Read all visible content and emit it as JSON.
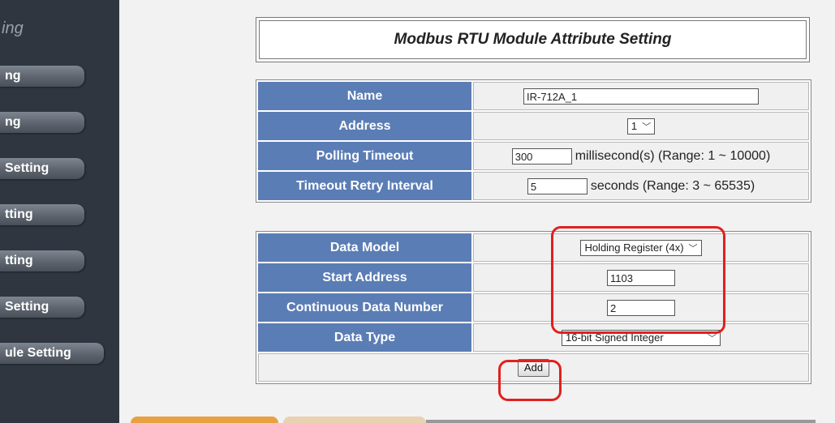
{
  "sidebar": {
    "header": "ing",
    "items": [
      {
        "label": "ng"
      },
      {
        "label": "ng"
      },
      {
        "label": " Setting"
      },
      {
        "label": "tting"
      },
      {
        "label": "tting"
      },
      {
        "label": "Setting"
      },
      {
        "label": "ule Setting"
      }
    ]
  },
  "main": {
    "title": "Modbus RTU Module Attribute Setting",
    "module": {
      "name_label": "Name",
      "name_value": "IR-712A_1",
      "address_label": "Address",
      "address_value": "1",
      "polling_label": "Polling Timeout",
      "polling_value": "300",
      "polling_unit": "millisecond(s) (Range: 1 ~ 10000)",
      "retry_label": "Timeout Retry Interval",
      "retry_value": "5",
      "retry_unit": "seconds (Range: 3 ~ 65535)"
    },
    "data": {
      "model_label": "Data Model",
      "model_value": "Holding Register (4x)",
      "start_label": "Start Address",
      "start_value": "1103",
      "count_label": "Continuous Data Number",
      "count_value": "2",
      "type_label": "Data Type",
      "type_value": "16-bit Signed Integer",
      "add_label": "Add"
    }
  },
  "colors": {
    "label_bg": "#5b7db5",
    "sidebar_bg": "#2f3640",
    "highlight": "#e02020",
    "tab_orange": "#e8a040"
  }
}
